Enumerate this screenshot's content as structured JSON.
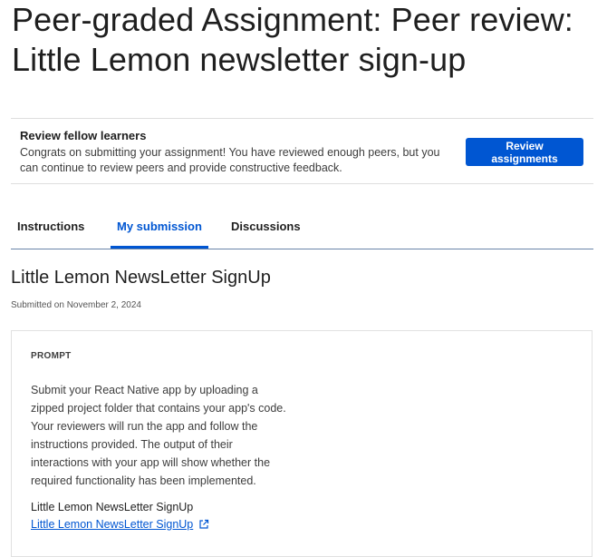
{
  "page": {
    "title": "Peer-graded Assignment: Peer review: Little Lemon newsletter sign-up"
  },
  "banner": {
    "heading": "Review fellow learners",
    "text": "Congrats on submitting your assignment! You have reviewed enough peers, but you can continue to review peers and provide constructive feedback.",
    "button_label": "Review assignments"
  },
  "tabs": [
    {
      "label": "Instructions",
      "active": false
    },
    {
      "label": "My submission",
      "active": true
    },
    {
      "label": "Discussions",
      "active": false
    }
  ],
  "submission": {
    "title": "Little Lemon NewsLetter SignUp",
    "date": "Submitted on November 2, 2024"
  },
  "prompt": {
    "label": "PROMPT",
    "text": "Submit your React Native app by uploading a zipped project folder that contains your app's code. Your reviewers will run the app and follow the instructions provided. The output of their interactions with your app will show whether the required functionality has been implemented.",
    "project_name": "Little Lemon NewsLetter SignUp",
    "link_text": "Little Lemon NewsLetter SignUp"
  },
  "colors": {
    "accent": "#0056d2",
    "tab_underline": "#6a85a8"
  },
  "icons": {
    "link": "external-link-icon"
  }
}
